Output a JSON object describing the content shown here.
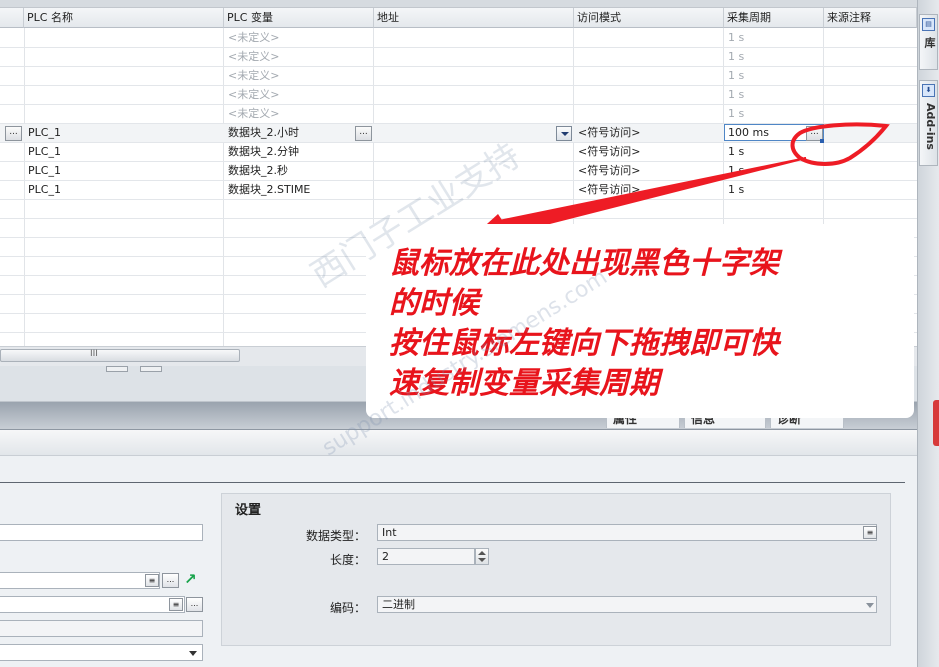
{
  "table": {
    "headers": [
      "PLC 名称",
      "PLC 变量",
      "地址",
      "访问模式",
      "采集周期",
      "来源注释"
    ],
    "rows": [
      {
        "plc_name": "",
        "plc_var": "<未定义>",
        "address": "",
        "access": "",
        "cycle": "1 s",
        "placeholder": true
      },
      {
        "plc_name": "",
        "plc_var": "<未定义>",
        "address": "",
        "access": "",
        "cycle": "1 s",
        "placeholder": true
      },
      {
        "plc_name": "",
        "plc_var": "<未定义>",
        "address": "",
        "access": "",
        "cycle": "1 s",
        "placeholder": true
      },
      {
        "plc_name": "",
        "plc_var": "<未定义>",
        "address": "",
        "access": "",
        "cycle": "1 s",
        "placeholder": true
      },
      {
        "plc_name": "",
        "plc_var": "<未定义>",
        "address": "",
        "access": "",
        "cycle": "1 s",
        "placeholder": true
      },
      {
        "plc_name": "PLC_1",
        "plc_var": "数据块_2.小时",
        "address": "",
        "access": "<符号访问>",
        "cycle": "100 ms",
        "selected": true
      },
      {
        "plc_name": "PLC_1",
        "plc_var": "数据块_2.分钟",
        "address": "",
        "access": "<符号访问>",
        "cycle": "1 s"
      },
      {
        "plc_name": "PLC_1",
        "plc_var": "数据块_2.秒",
        "address": "",
        "access": "<符号访问>",
        "cycle": "1 s"
      },
      {
        "plc_name": "PLC_1",
        "plc_var": "数据块_2.STIME",
        "address": "",
        "access": "<符号访问>",
        "cycle": "1 s"
      }
    ],
    "browse_label": "...",
    "scroll_grip": "III"
  },
  "annotation": {
    "text": "鼠标放在此处出现黑色十字架\n的时候\n按住鼠标左键向下拖拽即可快\n速复制变量采集周期",
    "color": "#e8141c"
  },
  "watermark": {
    "line1": "西门子工业支持",
    "line2": "support.industry.siemens.com"
  },
  "inspector_tabs": [
    "属性",
    "信息",
    "诊断"
  ],
  "settings": {
    "title": "设置",
    "data_type_label": "数据类型：",
    "data_type_value": "Int",
    "length_label": "长度：",
    "length_value": "2",
    "encoding_label": "编码：",
    "encoding_value": "二进制"
  },
  "side_tabs": {
    "tab1": "库",
    "tab2": "Add-ins"
  }
}
